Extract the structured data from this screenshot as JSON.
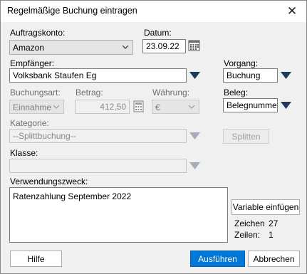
{
  "window": {
    "title": "Regelmäßige Buchung eintragen",
    "close_glyph": "✕"
  },
  "auftragskonto": {
    "label": "Auftragskonto:",
    "value": "Amazon"
  },
  "datum": {
    "label": "Datum:",
    "value": "23.09.22"
  },
  "empfaenger": {
    "label": "Empfänger:",
    "value": "Volksbank Staufen Eg"
  },
  "vorgang": {
    "label": "Vorgang:",
    "value": "Buchung"
  },
  "buchungsart": {
    "label": "Buchungsart:",
    "value": "Einnahme"
  },
  "betrag": {
    "label": "Betrag:",
    "value": "412,50"
  },
  "waehrung": {
    "label": "Währung:",
    "value": "€"
  },
  "beleg": {
    "label": "Beleg:",
    "value": "Belegnummer"
  },
  "kategorie": {
    "label": "Kategorie:",
    "value": "--Splittbuchung--"
  },
  "splitten": {
    "label": "Splitten"
  },
  "klasse": {
    "label": "Klasse:",
    "value": ""
  },
  "verwendungszweck": {
    "label": "Verwendungszweck:",
    "value": "Ratenzahlung September 2022"
  },
  "variable_button": {
    "label": "Variable einfügen"
  },
  "stats": {
    "zeichen_label": "Zeichen",
    "zeichen_value": "27",
    "zeilen_label": "Zeilen:",
    "zeilen_value": "1"
  },
  "buttons": {
    "hilfe": "Hilfe",
    "ausfuehren": "Ausführen",
    "abbrechen": "Abbrechen"
  },
  "icons": {
    "calendar": "calendar-icon",
    "calculator": "calculator-icon",
    "dropdown": "chevron-down-icon",
    "picker": "triangle-down-icon"
  },
  "colors": {
    "primary": "#0078d7",
    "dialog_bg": "#f0f0f0",
    "picker_arrow": "#1f3b5a"
  }
}
